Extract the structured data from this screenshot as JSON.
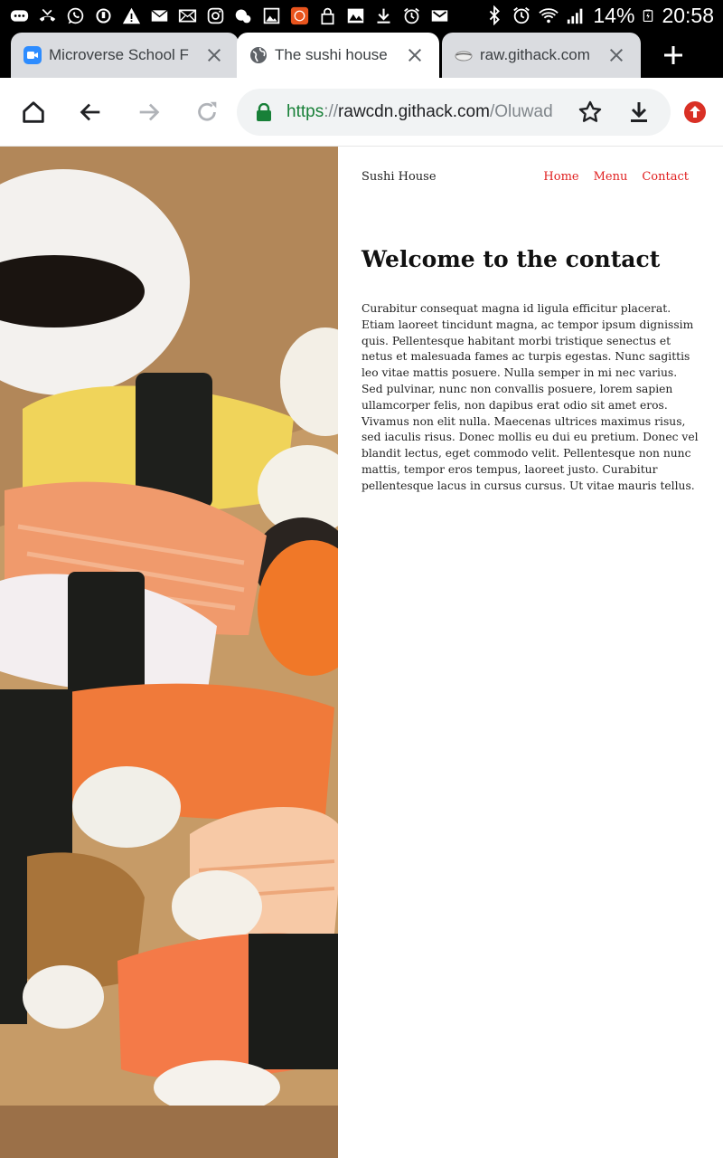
{
  "status_bar": {
    "icons": [
      "chat-bubble-icon",
      "missed-call-icon",
      "whatsapp-icon",
      "sync-icon",
      "warning-icon",
      "mail-icon",
      "mail-icon",
      "instagram-icon",
      "weather-icon",
      "gallery-icon",
      "app-icon",
      "lock-icon",
      "gallery-icon",
      "download-icon",
      "alarm-icon",
      "gmail-icon"
    ],
    "battery": "14%",
    "time": "20:58"
  },
  "tabs": [
    {
      "title": "Microverse School F",
      "active": false,
      "favicon": "zoom-icon"
    },
    {
      "title": "The sushi house",
      "active": true,
      "favicon": "globe-icon"
    },
    {
      "title": "raw.githack.com",
      "active": false,
      "favicon": "githack-icon"
    }
  ],
  "toolbar": {
    "url_scheme": "https",
    "url_sep": "://",
    "url_host": "rawcdn.githack.com",
    "url_path": "/Oluwad"
  },
  "page": {
    "brand": "Sushi House",
    "nav": [
      "Home",
      "Menu",
      "Contact"
    ],
    "heading": "Welcome to the contact",
    "paragraph": "Curabitur consequat magna id ligula efficitur placerat. Etiam laoreet tincidunt magna, ac tempor ipsum dignissim quis. Pellentesque habitant morbi tristique senectus et netus et malesuada fames ac turpis egestas. Nunc sagittis leo vitae mattis posuere. Nulla semper in mi nec varius. Sed pulvinar, nunc non convallis posuere, lorem sapien ullamcorper felis, non dapibus erat odio sit amet eros. Vivamus non elit nulla. Maecenas ultrices maximus risus, sed iaculis risus. Donec mollis eu dui eu pretium. Donec vel blandit lectus, eget commodo velit. Pellentesque non nunc mattis, tempor eros tempus, laoreet justo. Curabitur pellentesque lacus in cursus cursus. Ut vitae mauris tellus."
  },
  "colors": {
    "nav_link": "#e02020",
    "secure_green": "#188038",
    "update_badge": "#d93025"
  }
}
